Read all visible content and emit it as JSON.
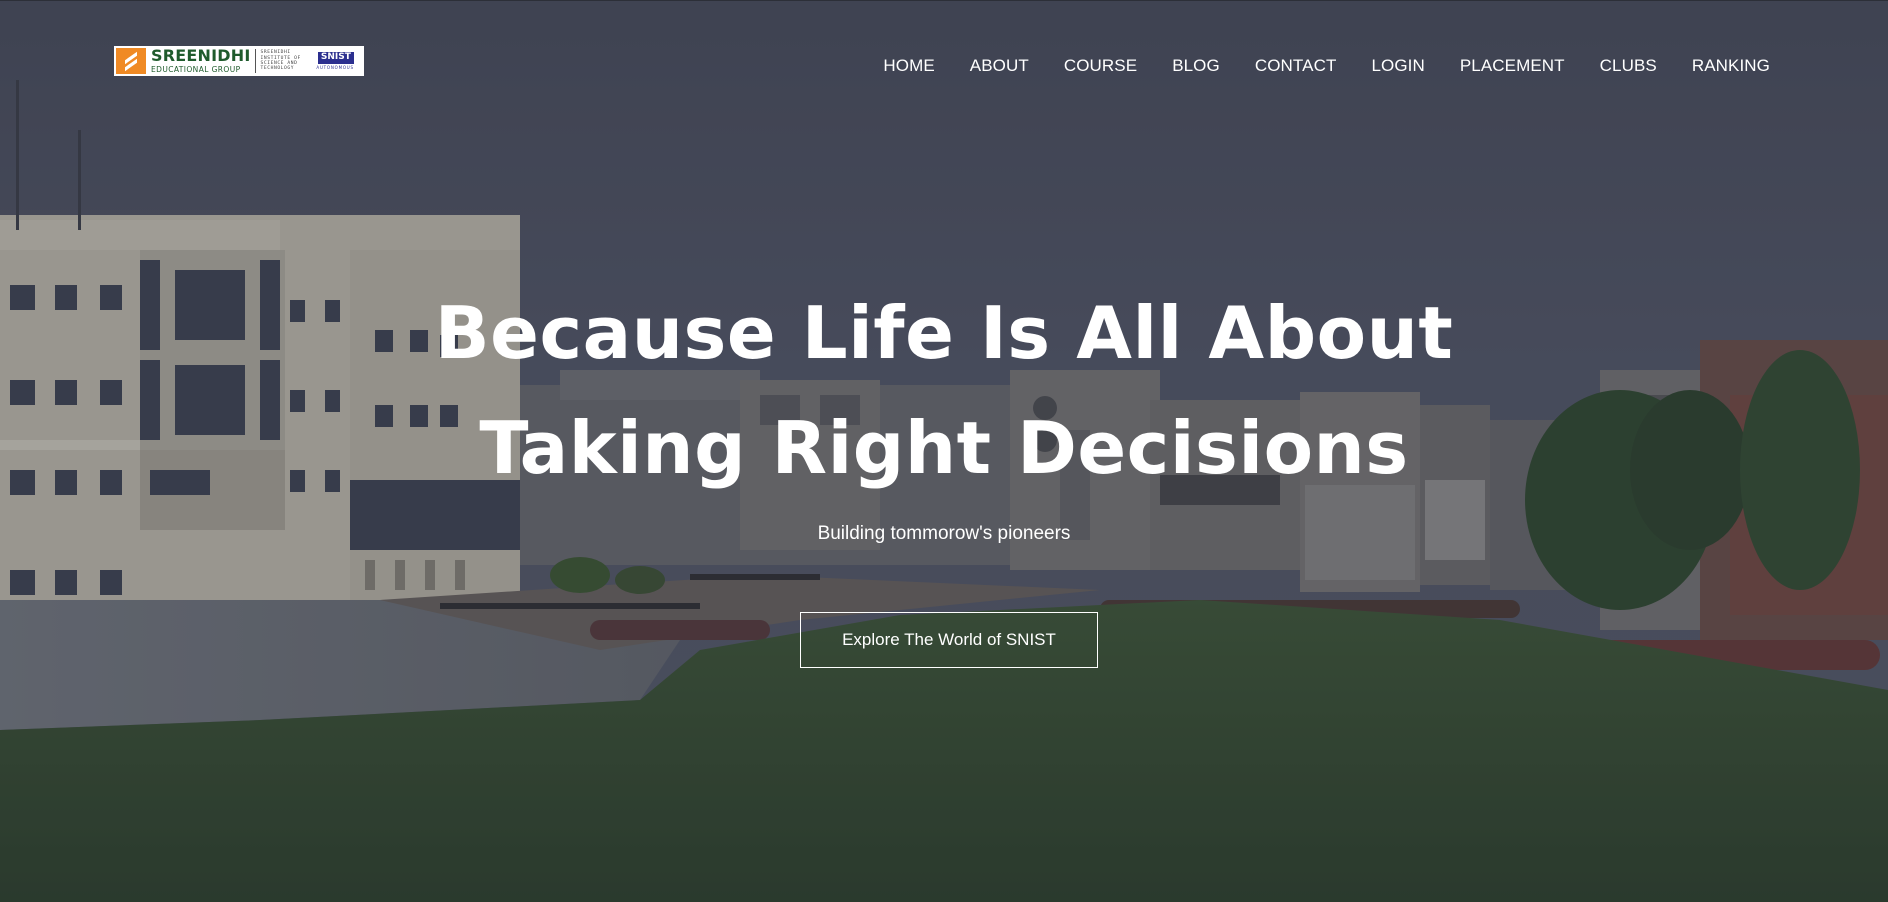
{
  "header": {
    "logo": {
      "name": "SREENIDHI",
      "subtitle": "EDUCATIONAL GROUP",
      "institute_lines": [
        "SREENIDHI",
        "INSTITUTE OF",
        "SCIENCE AND",
        "TECHNOLOGY"
      ],
      "badge": "SNIST",
      "badge_sub": "AUTONOMOUS"
    },
    "nav": [
      "HOME",
      "ABOUT",
      "COURSE",
      "BLOG",
      "CONTACT",
      "LOGIN",
      "PLACEMENT",
      "CLUBS",
      "RANKING"
    ]
  },
  "hero": {
    "headline_line1": "Because Life Is All About",
    "headline_line2": "Taking Right Decisions",
    "tagline": "Building tommorow's pioneers",
    "cta_label": "Explore The World of SNIST"
  },
  "colors": {
    "logo_green": "#1f5b2c",
    "logo_orange": "#f08a24",
    "badge_blue": "#2b2f8f"
  }
}
